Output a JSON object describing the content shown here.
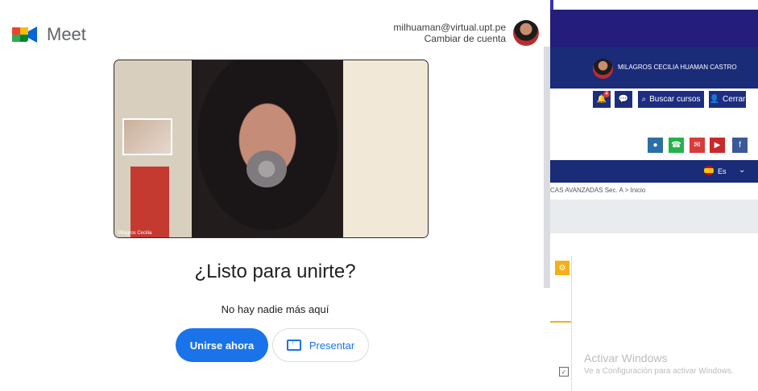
{
  "meet": {
    "brand": "Meet",
    "account_email": "milhuaman@virtual.upt.pe",
    "switch_account": "Cambiar de cuenta",
    "ready_title": "¿Listo para unirte?",
    "nobody_here": "No hay nadie más aquí",
    "join_button": "Unirse ahora",
    "present_button": "Presentar",
    "video_name": "Milagros Cecilia"
  },
  "site": {
    "profile_name": "MILAGROS CECILIA HUAMAN CASTRO",
    "notification_count": "4",
    "search_courses": "Buscar cursos",
    "logout": "Cerrar",
    "language": "Es",
    "breadcrumb": "CAS AVANZADAS Sec. A > Inicio",
    "windows_line1": "Activar Windows",
    "windows_line2": "Ve a Configuración para activar Windows."
  },
  "icons": {
    "meet_logo": "meet-logo-icon",
    "profile_avatar": "avatar-icon",
    "bell": "bell-icon",
    "chat": "chat-icon",
    "search": "search-icon",
    "user": "user-icon",
    "settings": "gear-icon",
    "checkbox": "checkbox-icon"
  },
  "colors": {
    "meet_blue": "#1a73e8",
    "site_navy": "#1a2b78",
    "site_accent": "#f4b018"
  }
}
